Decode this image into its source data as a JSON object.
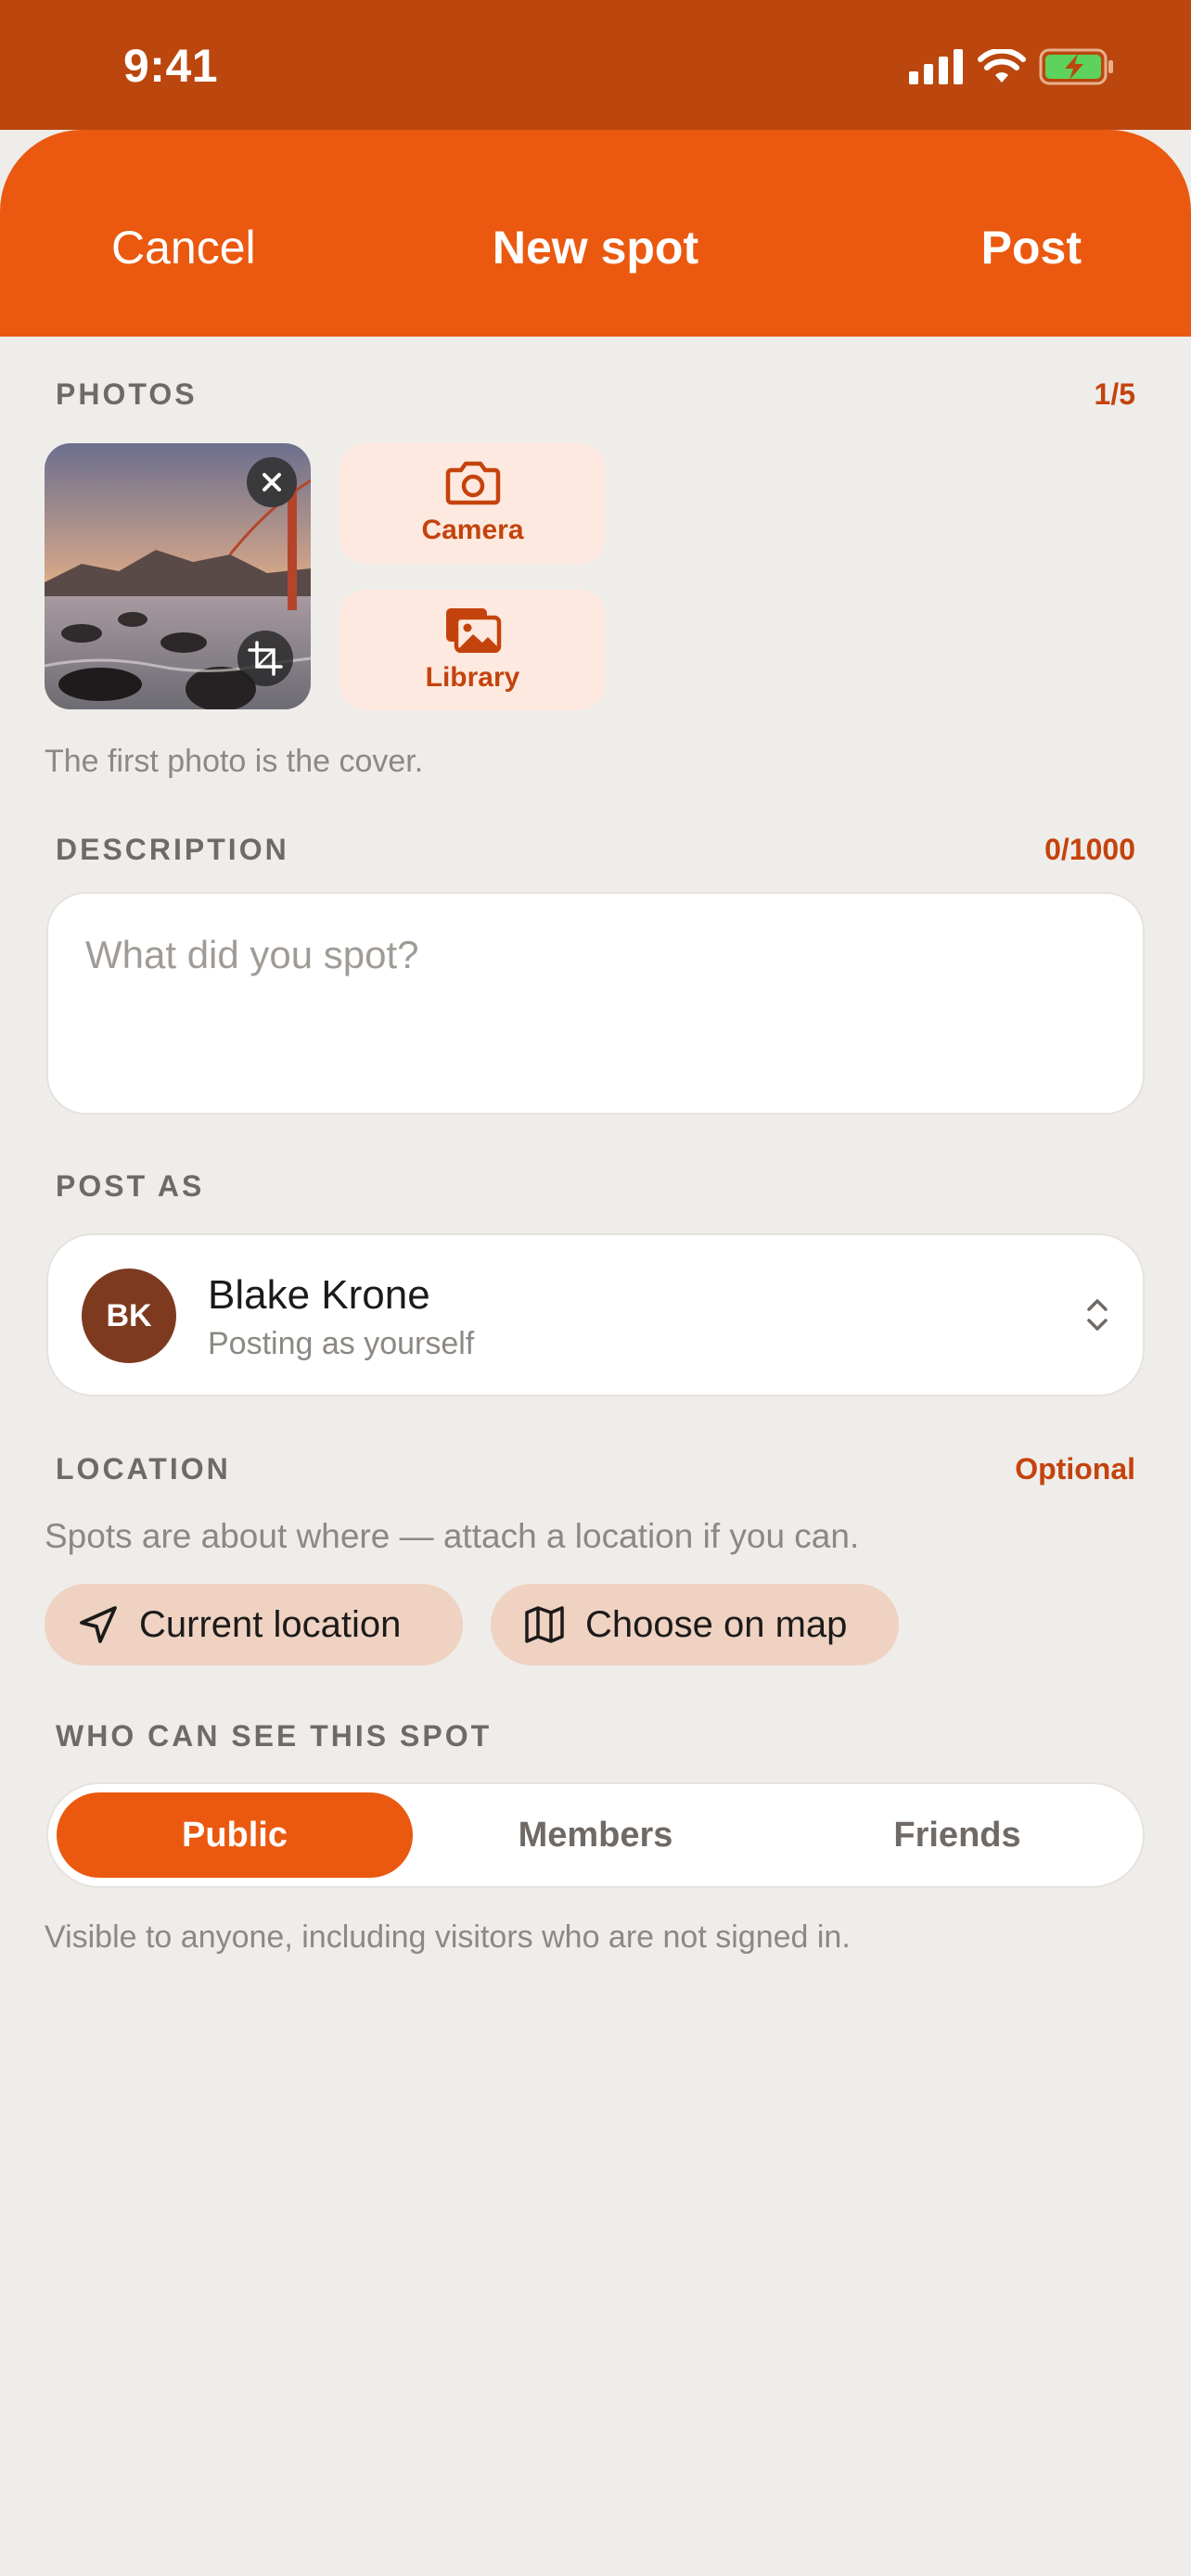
{
  "status_bar": {
    "time": "9:41"
  },
  "header": {
    "cancel_label": "Cancel",
    "title": "New spot",
    "post_label": "Post"
  },
  "photos": {
    "section_label": "PHOTOS",
    "counter": "1/5",
    "camera_label": "Camera",
    "library_label": "Library",
    "hint": "The first photo is the cover."
  },
  "description": {
    "section_label": "DESCRIPTION",
    "counter": "0/1000",
    "placeholder": "What did you spot?",
    "value": ""
  },
  "post_as": {
    "section_label": "POST AS",
    "initials": "BK",
    "name": "Blake Krone",
    "subtitle": "Posting as yourself"
  },
  "location": {
    "section_label": "LOCATION",
    "optional_label": "Optional",
    "hint": "Spots are about where — attach a location if you can.",
    "current_label": "Current location",
    "map_label": "Choose on map"
  },
  "visibility": {
    "section_label": "WHO CAN SEE THIS SPOT",
    "options": [
      "Public",
      "Members",
      "Friends"
    ],
    "selected": "Public",
    "hint": "Visible to anyone, including visitors who are not signed in."
  },
  "colors": {
    "status_bar": "#bb470e",
    "accent": "#ea590f",
    "accent_text": "#c4430c",
    "chip_bg": "#efd2c2",
    "add_button_bg": "#fde9df",
    "page_bg": "#efedea",
    "avatar": "#7e3a1f"
  },
  "icons": {
    "signal": "cellular-signal-icon",
    "wifi": "wifi-icon",
    "battery": "battery-charging-icon",
    "camera": "camera-icon",
    "library": "photo-library-icon",
    "remove": "close-icon",
    "crop": "crop-icon",
    "chevron": "chevron-up-down-icon",
    "location": "location-arrow-icon",
    "map": "map-icon"
  }
}
